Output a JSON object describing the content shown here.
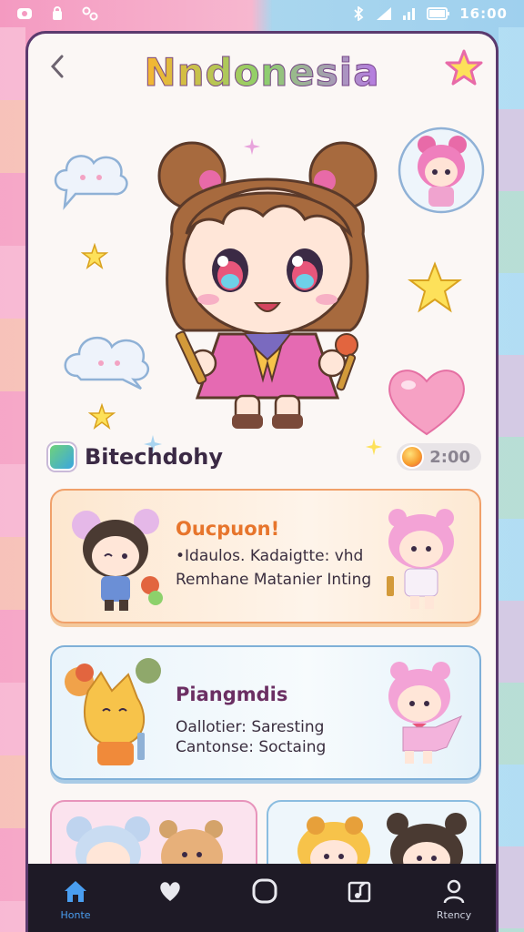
{
  "status_bar": {
    "time": "16:00"
  },
  "header": {
    "title": "Nndonesia"
  },
  "profile": {
    "name": "Bitechdohy",
    "points": "2:00"
  },
  "panels": [
    {
      "title": "Oucpuon!",
      "lines": [
        "•Idaulos. Kadaigtte: vhd",
        "Remhane Matanier Inting"
      ]
    },
    {
      "title": "Piangmdis",
      "lines": [
        "Oallotier: Saresting",
        "Cantonse: Soctaing"
      ]
    }
  ],
  "tabs": [
    {
      "label": "Honte",
      "icon": "home-icon"
    },
    {
      "label": "",
      "icon": "heart-icon"
    },
    {
      "label": "",
      "icon": "camera-icon"
    },
    {
      "label": "",
      "icon": "music-icon"
    },
    {
      "label": "Rtency",
      "icon": "profile-icon"
    }
  ],
  "colors": {
    "accent": "#4a9ef0",
    "panel_title_1": "#e7752c",
    "panel_title_2": "#6b2f63",
    "tab_bar": "#1e1a26"
  }
}
